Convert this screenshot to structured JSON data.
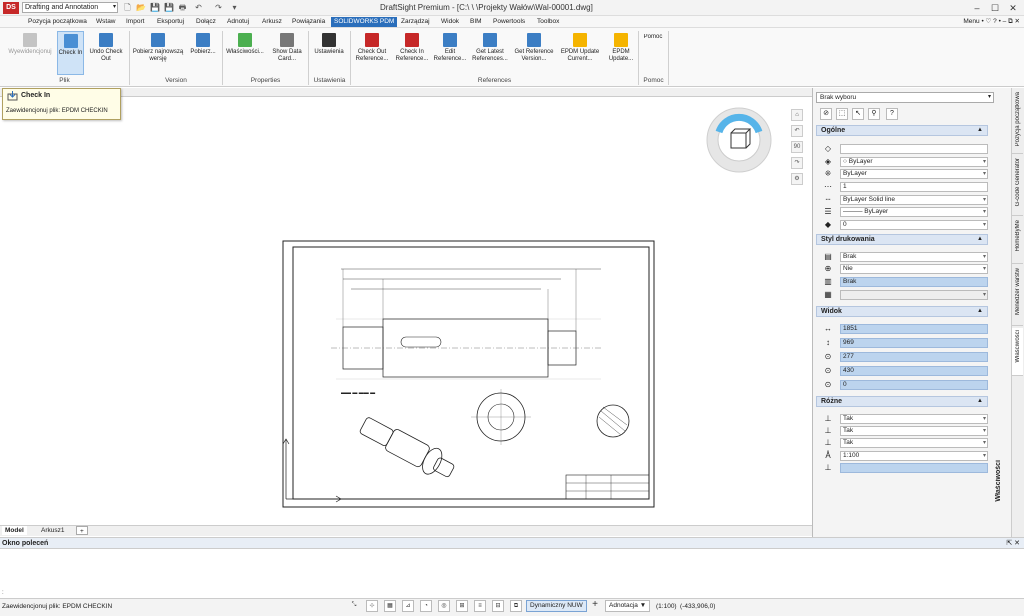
{
  "titlebar": {
    "logo": "DS",
    "workspace": "Drafting and Annotation",
    "title": "DraftSight Premium - [C:\\            \\            \\Projekty Wałów\\Wal-00001.dwg]",
    "min": "–",
    "max": "☐",
    "close": "✕"
  },
  "menus": [
    "Pozycja początkowa",
    "Wstaw",
    "Import",
    "Eksportuj",
    "Dołącz",
    "Adnotuj",
    "Arkusz",
    "Powiązania",
    "SOLIDWORKS PDM",
    "Zarządzaj",
    "Widok",
    "BIM",
    "Powertools",
    "Toolbox"
  ],
  "menu_right": "Menu  •  ♡    ?  •  –  ⧉  ✕",
  "ribbon": {
    "buttons": [
      {
        "label": "Wyewidencjonuj",
        "color": "#b0b0b0"
      },
      {
        "label": "Check In",
        "color": "#4a8fd4"
      },
      {
        "label": "Undo Check Out",
        "color": "#3c7ec4"
      },
      {
        "label": "Pobierz najnowszą wersję",
        "color": "#3c7ec4"
      },
      {
        "label": "Pobierz...",
        "color": "#3c7ec4"
      },
      {
        "label": "Właściwości...",
        "color": "#4caf50"
      },
      {
        "label": "Show Data Card...",
        "color": "#666"
      },
      {
        "label": "Ustawienia",
        "color": "#333"
      },
      {
        "label": "Check Out Reference...",
        "color": "#c62828"
      },
      {
        "label": "Check In Reference...",
        "color": "#c62828"
      },
      {
        "label": "Edit Reference...",
        "color": "#3c7ec4"
      },
      {
        "label": "Get Latest References...",
        "color": "#3c7ec4"
      },
      {
        "label": "Get Reference Version...",
        "color": "#3c7ec4"
      },
      {
        "label": "EPDM Update Current...",
        "color": "#f5b400"
      },
      {
        "label": "EPDM Update...",
        "color": "#f5b400"
      }
    ],
    "groups": [
      "Plik",
      "Version",
      "Properties",
      "Ustawienia",
      "References",
      "Pomoc"
    ],
    "help": "Pomoc"
  },
  "tooltip": {
    "title": "Check In",
    "desc": "Zaewidencjonuj plik: EPDM CHECKIN"
  },
  "navcube": {
    "btn_zoom": "90"
  },
  "layout_tabs": [
    "Model",
    "Arkusz1",
    "+"
  ],
  "command": {
    "title": "Okno poleceń",
    "colon": ":",
    "pin": "⇱  ✕"
  },
  "status": {
    "message": "Zaewidencjonuj plik: EPDM CHECKIN",
    "dyn": "Dynamiczny NUW",
    "plus": "+",
    "annotation": "Adnotacja  ▼",
    "scale": "(1:100)",
    "coords": "(-433,906,0)"
  },
  "properties": {
    "selection": "Brak wyboru",
    "general_title": "Ogólne",
    "general_rows": [
      "",
      "○ ByLayer",
      "ByLayer",
      "1",
      "ByLayer       Solid line",
      "——— ByLayer",
      "0"
    ],
    "print_title": "Styl drukowania",
    "print_rows": [
      "Brak",
      "Nie",
      "Brak",
      ""
    ],
    "view_title": "Widok",
    "view_rows": [
      "1851",
      "969",
      "277",
      "430",
      "0"
    ],
    "misc_title": "Różne",
    "misc_rows": [
      "Tak",
      "Tak",
      "Tak",
      "1:100",
      ""
    ],
    "side_label": "Właściwości"
  },
  "vtabs": [
    "Pozycja początkowa",
    "G-code Generator",
    "HomeByMe",
    "Menedżer warstw",
    "Właściwości"
  ]
}
